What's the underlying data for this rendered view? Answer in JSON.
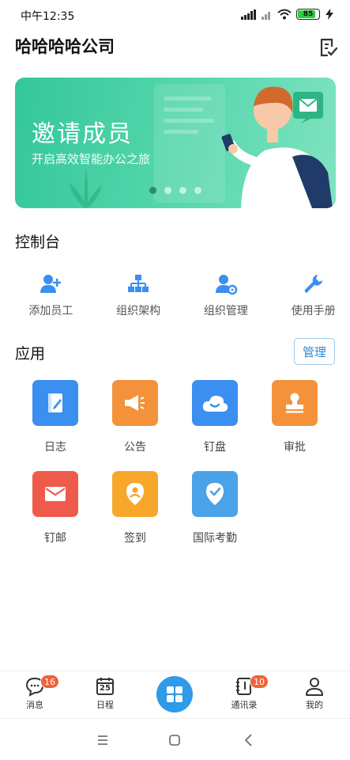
{
  "status_bar": {
    "time": "中午12:35",
    "battery": "85"
  },
  "header": {
    "title": "哈哈哈哈公司"
  },
  "banner": {
    "title": "邀请成员",
    "subtitle": "开启高效智能办公之旅",
    "dots": 4,
    "active_dot": 0
  },
  "console": {
    "title": "控制台",
    "items": [
      {
        "label": "添加员工",
        "icon": "add-user-icon"
      },
      {
        "label": "组织架构",
        "icon": "org-chart-icon"
      },
      {
        "label": "组织管理",
        "icon": "user-settings-icon"
      },
      {
        "label": "使用手册",
        "icon": "wrench-icon"
      }
    ]
  },
  "apps": {
    "title": "应用",
    "manage_label": "管理",
    "items": [
      {
        "label": "日志",
        "icon": "notebook-icon",
        "color": "#3a8ff0"
      },
      {
        "label": "公告",
        "icon": "megaphone-icon",
        "color": "#f3923a"
      },
      {
        "label": "钉盘",
        "icon": "cloud-icon",
        "color": "#3a8ff0"
      },
      {
        "label": "审批",
        "icon": "stamp-icon",
        "color": "#f3923a"
      },
      {
        "label": "钉邮",
        "icon": "mail-icon",
        "color": "#ef5b4a"
      },
      {
        "label": "签到",
        "icon": "location-pin-icon",
        "color": "#f7a72a"
      },
      {
        "label": "国际考勤",
        "icon": "check-pin-icon",
        "color": "#4aa3e8"
      }
    ]
  },
  "bottom_nav": {
    "items": [
      {
        "label": "消息",
        "icon": "chat-bubble-icon",
        "badge": "16"
      },
      {
        "label": "日程",
        "icon": "calendar-icon",
        "day": "25"
      },
      {
        "label": "",
        "icon": "workbench-grid-icon"
      },
      {
        "label": "通讯录",
        "icon": "contacts-book-icon",
        "badge": "10"
      },
      {
        "label": "我的",
        "icon": "person-icon"
      }
    ]
  },
  "colors": {
    "accent": "#2f9ae8",
    "banner": "#40cc9f",
    "badge": "#f1623a"
  }
}
